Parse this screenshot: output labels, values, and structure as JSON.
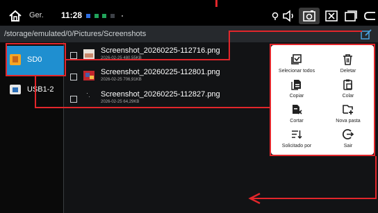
{
  "statusbar": {
    "app_label": "Ger.",
    "time": "11:28",
    "colors": {
      "sq1": "#2f6fe4",
      "sq2": "#21a35a",
      "sq3": "#21a35a",
      "sq4": "#3c4046"
    },
    "icons": [
      "home-icon",
      "location-icon",
      "volume-icon",
      "camera-icon",
      "close-box-icon",
      "window-icon",
      "back-icon"
    ]
  },
  "path": {
    "text": "/storage/emulated/0/Pictures/Screenshots"
  },
  "sidebar": {
    "drives": [
      {
        "label": "SD0",
        "icon": "sd-card-icon",
        "active": true
      },
      {
        "label": "USB1-2",
        "icon": "usb-drive-icon",
        "active": false
      }
    ]
  },
  "files": [
    {
      "name": "Screenshot_20260225-112716.png",
      "meta": "2026-02-25  480,55KB"
    },
    {
      "name": "Screenshot_20260225-112801.png",
      "meta": "2026-02-25  706,91KB"
    },
    {
      "name": "Screenshot_20260225-112827.png",
      "meta": "2026-02-25  64,29KB"
    }
  ],
  "menu": {
    "items": [
      {
        "label": "Selecionar todos",
        "icon": "select-all-icon"
      },
      {
        "label": "Deletar",
        "icon": "trash-icon"
      },
      {
        "label": "Copiar",
        "icon": "copy-icon"
      },
      {
        "label": "Colar",
        "icon": "paste-icon"
      },
      {
        "label": "Cortar",
        "icon": "cut-icon"
      },
      {
        "label": "Nova pasta",
        "icon": "new-folder-icon"
      },
      {
        "label": "Solicitado por",
        "icon": "sort-icon"
      },
      {
        "label": "Sair",
        "icon": "exit-icon"
      }
    ]
  },
  "annotation_color": "#e2262b"
}
